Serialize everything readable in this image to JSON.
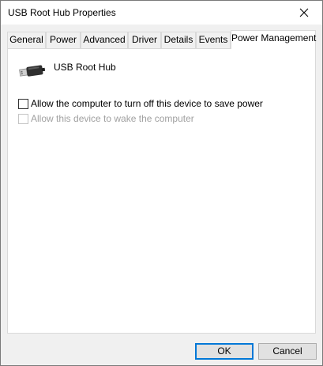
{
  "window": {
    "title": "USB Root Hub Properties"
  },
  "tabs": [
    {
      "label": "General",
      "active": false
    },
    {
      "label": "Power",
      "active": false
    },
    {
      "label": "Advanced",
      "active": false
    },
    {
      "label": "Driver",
      "active": false
    },
    {
      "label": "Details",
      "active": false
    },
    {
      "label": "Events",
      "active": false
    },
    {
      "label": "Power Management",
      "active": true
    }
  ],
  "device": {
    "icon": "usb-connector-icon",
    "name": "USB Root Hub"
  },
  "options": [
    {
      "label": "Allow the computer to turn off this device to save power",
      "checked": false,
      "enabled": true
    },
    {
      "label": "Allow this device to wake the computer",
      "checked": false,
      "enabled": false
    }
  ],
  "buttons": {
    "ok_label": "OK",
    "cancel_label": "Cancel"
  },
  "colors": {
    "accent": "#0078d7",
    "panel_background": "#ffffff",
    "dialog_background": "#f0f0f0",
    "disabled_text": "#a0a0a0"
  }
}
